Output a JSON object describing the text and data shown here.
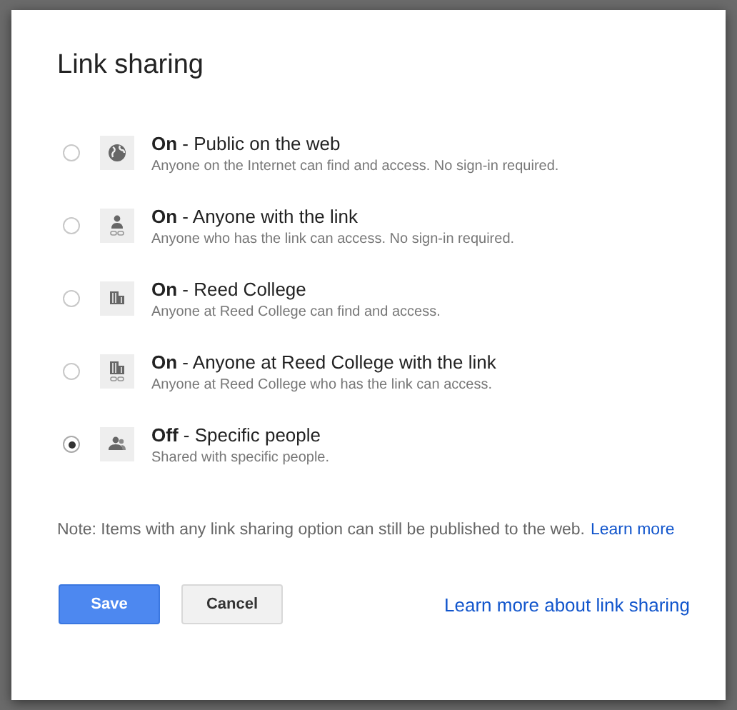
{
  "dialog": {
    "title": "Link sharing"
  },
  "options": [
    {
      "kind": "globe",
      "label": "**On** - Public on the web",
      "description": "Anyone on the Internet can find and access. No sign-in required.",
      "selected": false
    },
    {
      "kind": "person-link",
      "label": "**On** - Anyone with the link",
      "description": "Anyone who has the link can access. No sign-in required.",
      "selected": false
    },
    {
      "kind": "building",
      "label": "**On** - Reed College",
      "description": "Anyone at Reed College can find and access.",
      "selected": false
    },
    {
      "kind": "building-link",
      "label": "**On** - Anyone at Reed College with the link",
      "description": "Anyone at Reed College who has the link can access.",
      "selected": false
    },
    {
      "kind": "people",
      "label": "**Off** - Specific people",
      "description": "Shared with specific people.",
      "selected": true
    }
  ],
  "note": {
    "text": "Note: Items with any link sharing option can still be published to the web.",
    "link": "Learn more"
  },
  "buttons": {
    "save": "Save",
    "cancel": "Cancel"
  },
  "help_link": "Learn more about link sharing"
}
